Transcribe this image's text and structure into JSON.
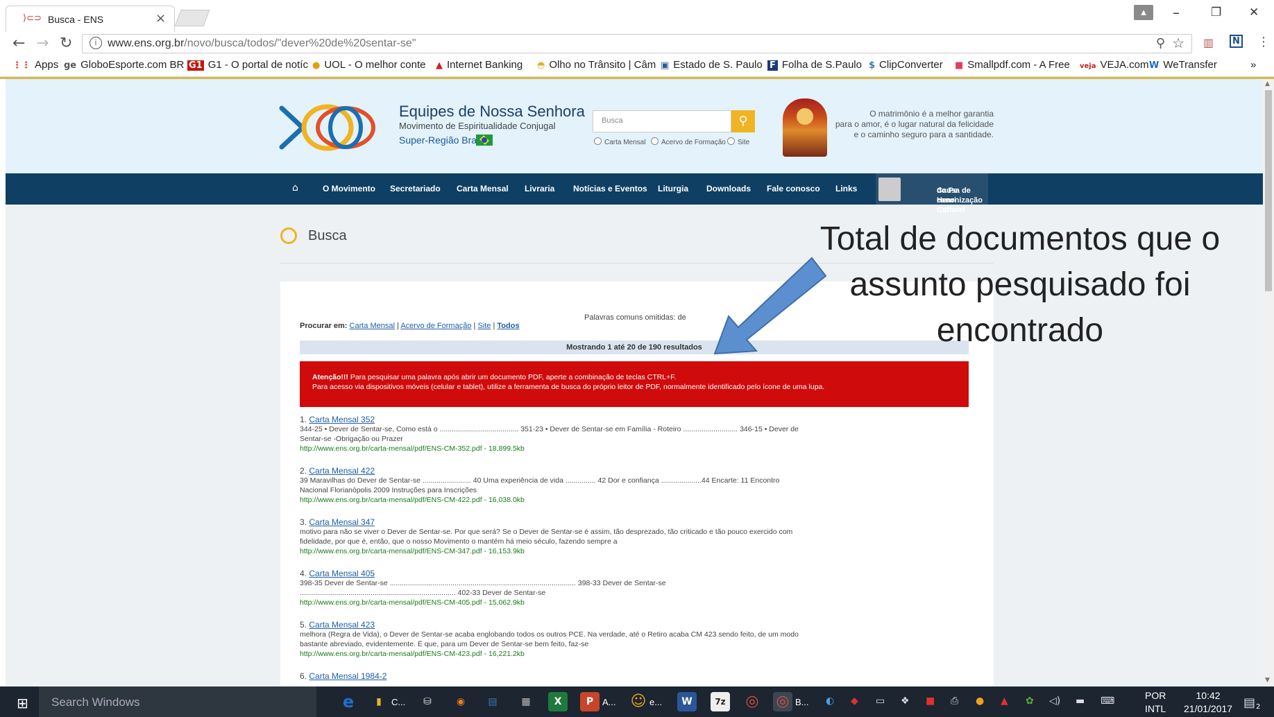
{
  "browser": {
    "tab_title": "Busca - ENS",
    "tab_close": "×",
    "url_host": "www.ens.org.br",
    "url_path": "/novo/busca/todos/\"dever%20de%20sentar-se\"",
    "win_min": "–",
    "win_restore": "❐",
    "win_close": "✕",
    "bookmarks": [
      {
        "icon": "⋮⋮",
        "label": "Apps"
      },
      {
        "icon": "ge",
        "label": "GloboEsporte.com BR"
      },
      {
        "icon": "G1",
        "label": "G1 - O portal de notíc"
      },
      {
        "icon": "●",
        "label": "UOL - O melhor conte"
      },
      {
        "icon": "▲",
        "label": "Internet Banking"
      },
      {
        "icon": "◓",
        "label": "Olho no Trânsito | Câm"
      },
      {
        "icon": "▣",
        "label": "Estado de S. Paulo"
      },
      {
        "icon": "F",
        "label": "Folha de S.Paulo"
      },
      {
        "icon": "$",
        "label": "ClipConverter"
      },
      {
        "icon": "■",
        "label": "Smallpdf.com - A Free"
      },
      {
        "icon": "veja",
        "label": "VEJA.com"
      },
      {
        "icon": "W",
        "label": "WeTransfer"
      }
    ],
    "bookmarks_more": "»"
  },
  "site": {
    "name": "Equipes de Nossa Senhora",
    "tagline": "Movimento de Espiritualidade Conjugal",
    "region": "Super-Região Brasil",
    "search_placeholder": "Busca",
    "search_options": [
      "Carta Mensal",
      "Acervo de Formação",
      "Site"
    ],
    "quote_lines": [
      "O matrimônio é a melhor garantia",
      "para o amor, é o lugar natural da felicidade",
      "e o caminho seguro para a santidade."
    ],
    "nav": [
      "O Movimento",
      "Secretariado",
      "Carta Mensal",
      "Livraria",
      "Notícias e Eventos",
      "Liturgia",
      "Downloads",
      "Fale conosco",
      "Links"
    ],
    "nav_causa": [
      "Causa de canonização",
      "do Pe Henri Caffarel"
    ]
  },
  "search": {
    "heading": "Busca",
    "omitted": "Palavras comuns omitidas: de",
    "procurar_label": "Procurar em:",
    "procurar_links": [
      "Carta Mensal",
      "Acervo de Formação",
      "Site",
      "Todos"
    ],
    "showing": "Mostrando 1 até 20 de 190 resultados",
    "alert_line1_bold": "Atenção!!!",
    "alert_line1": " Para pesquisar uma palavra após abrir um documento PDF, aperte a combinação de teclas CTRL+F.",
    "alert_line2": "Para acesso via dispositivos móveis (celular e tablet), utilize a ferramenta de busca do próprio leitor de PDF, normalmente identificado pelo ícone de uma lupa.",
    "results": [
      {
        "num": "1.",
        "title": "Carta Mensal 352",
        "snippet": "344-25 • Dever de Sentar-se, Como está o ....................................... 351-23 • Dever de Sentar-se em Família - Roteiro ........................... 346-15 • Dever de Sentar-se -Obrigação ou Prazer",
        "link": "http://www.ens.org.br/carta-mensal/pdf/ENS-CM-352.pdf - 18,899.5kb"
      },
      {
        "num": "2.",
        "title": "Carta Mensal 422",
        "snippet": "39 Maravilhas do Dever de Sentar-se ........................ 40 Uma experiência de vida ............... 42 Dor e confiança ....................44 Encarte: 11 Encontro Nacional Florianópolis 2009 Instruções para Inscrições",
        "link": "http://www.ens.org.br/carta-mensal/pdf/ENS-CM-422.pdf - 16,038.0kb"
      },
      {
        "num": "3.",
        "title": "Carta Mensal 347",
        "snippet": "motivo para não se viver o Dever de Sentar-se. Por que será? Se o Dever de Sentar-se é assim, tão desprezado, tão criticado e tão pouco exercido com fidelidade, por que é, então, que o nosso Movimento o mantém há meio século, fazendo sempre a",
        "link": "http://www.ens.org.br/carta-mensal/pdf/ENS-CM-347.pdf - 16,153.9kb"
      },
      {
        "num": "4.",
        "title": "Carta Mensal 405",
        "snippet": "398-35 Dever de Sentar-se ............................................................................................ 398-33 Dever de Sentar-se ............................................................................. 402-33 Dever de Sentar-se",
        "link": "http://www.ens.org.br/carta-mensal/pdf/ENS-CM-405.pdf - 15,062.9kb"
      },
      {
        "num": "5.",
        "title": "Carta Mensal 423",
        "snippet": "melhora (Regra de Vida), o Dever de Sentar-se acaba englobando todos os outros PCE. Na verdade, até o Retiro acaba CM 423 sendo feito, de um modo bastante abreviado, evidentemente. É que, para um Dever de Sentar-se bem feito, faz-se",
        "link": "http://www.ens.org.br/carta-mensal/pdf/ENS-CM-423.pdf - 16,221.2kb"
      },
      {
        "num": "6.",
        "title": "Carta Mensal 1984-2",
        "snippet": "",
        "link": ""
      }
    ]
  },
  "annotation": {
    "lines": [
      "Total de documentos que o",
      "assunto pesquisado foi",
      "encontrado"
    ]
  },
  "taskbar": {
    "search_placeholder": "Search Windows",
    "apps": [
      {
        "icon": "e",
        "label": "",
        "color": "#1f6fd0"
      },
      {
        "icon": "▮",
        "label": "C...",
        "color": "#e6b42a"
      },
      {
        "icon": "⛁",
        "label": "",
        "color": "#555"
      },
      {
        "icon": "◉",
        "label": "",
        "color": "#f07b1a"
      },
      {
        "icon": "▤",
        "label": "",
        "color": "#3a78c2"
      },
      {
        "icon": "▦",
        "label": "",
        "color": "#666"
      },
      {
        "icon": "X",
        "label": "",
        "color": "#1e7a3c"
      },
      {
        "icon": "P",
        "label": "A...",
        "color": "#c8442b"
      },
      {
        "icon": "☺",
        "label": "e...",
        "color": "#e8a21a"
      },
      {
        "icon": "W",
        "label": "",
        "color": "#2b5797"
      },
      {
        "icon": "7z",
        "label": "",
        "color": "#333"
      },
      {
        "icon": "◎",
        "label": "",
        "color": "#dd4b39"
      },
      {
        "icon": "◎",
        "label": "B...",
        "color": "#dd4b39"
      }
    ],
    "lang_top": "POR",
    "lang_bottom": "INTL",
    "time": "10:42",
    "date": "21/01/2017",
    "notif_count": "2"
  }
}
